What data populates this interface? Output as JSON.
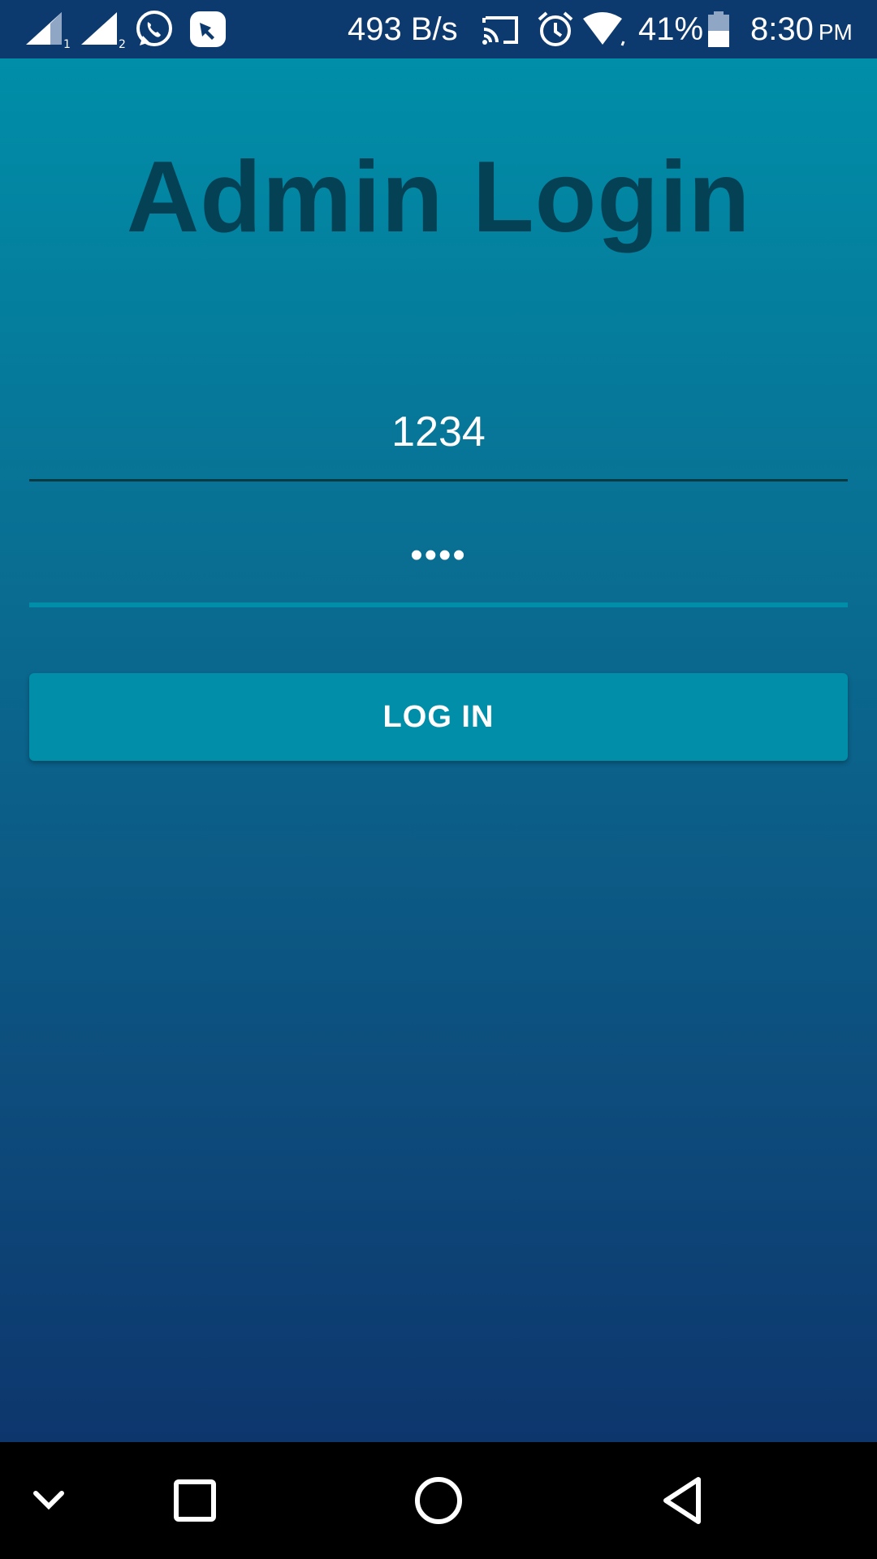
{
  "status_bar": {
    "net_speed": "493 B/s",
    "battery": "41%",
    "time": "8:30",
    "ampm": "PM",
    "icons": [
      "signal-sim1-icon",
      "signal-sim2-icon",
      "whatsapp-icon",
      "app-notification-icon",
      "cast-icon",
      "alarm-icon",
      "wifi-icon",
      "battery-icon"
    ]
  },
  "login": {
    "title": "Admin Login",
    "username_value": "1234",
    "password_value": "••••",
    "login_button": "LOG IN"
  },
  "nav_bar": {
    "icons": [
      "notification-collapse-icon",
      "recents-icon",
      "home-icon",
      "back-icon"
    ]
  },
  "colors": {
    "status_bar_bg": "#0d3a6e",
    "gradient_top": "#008ea8",
    "gradient_bottom": "#0d366d",
    "title_color": "#044154",
    "button_bg": "#008ea8",
    "field_focus_line": "#008ea8"
  }
}
